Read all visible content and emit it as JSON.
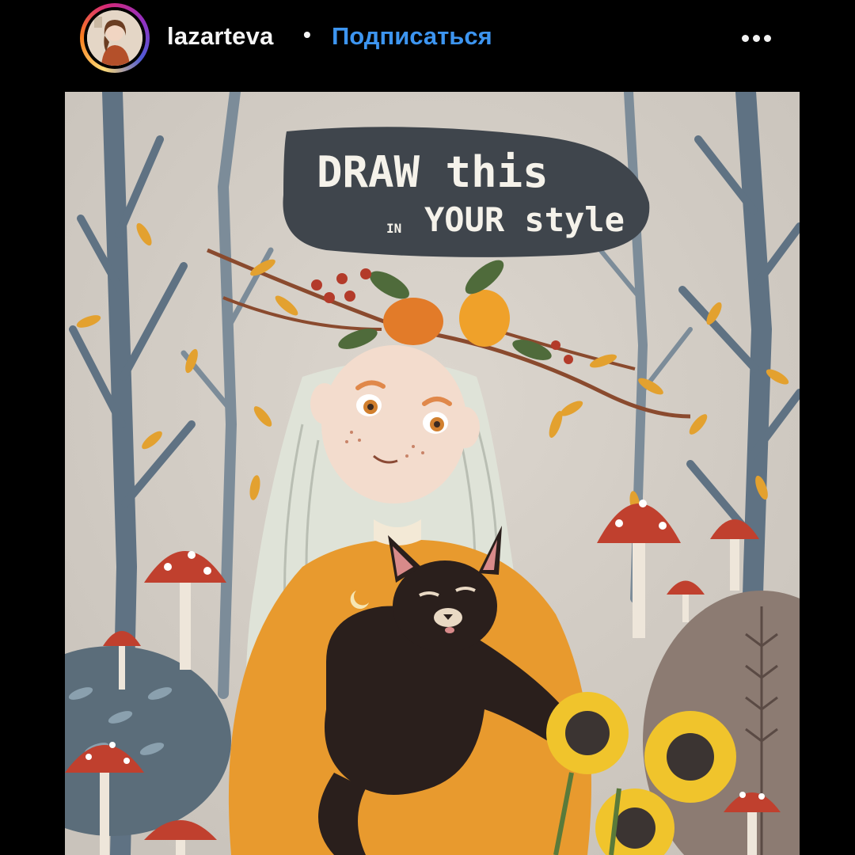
{
  "post_header": {
    "username": "lazarteva",
    "separator": "•",
    "follow_label": "Подписаться",
    "more_icon": "more-horizontal-icon",
    "avatar_icon": "profile-avatar-icon"
  },
  "artwork": {
    "title_line1": "DRAW this",
    "title_in": "IN",
    "title_line2": "YOUR style"
  },
  "colors": {
    "background": "#000000",
    "username": "#f5f5f5",
    "follow": "#3d95f0",
    "artwork_bg": "#d6d1ca",
    "sweater": "#e89a2e",
    "cat": "#2a1f1c"
  }
}
